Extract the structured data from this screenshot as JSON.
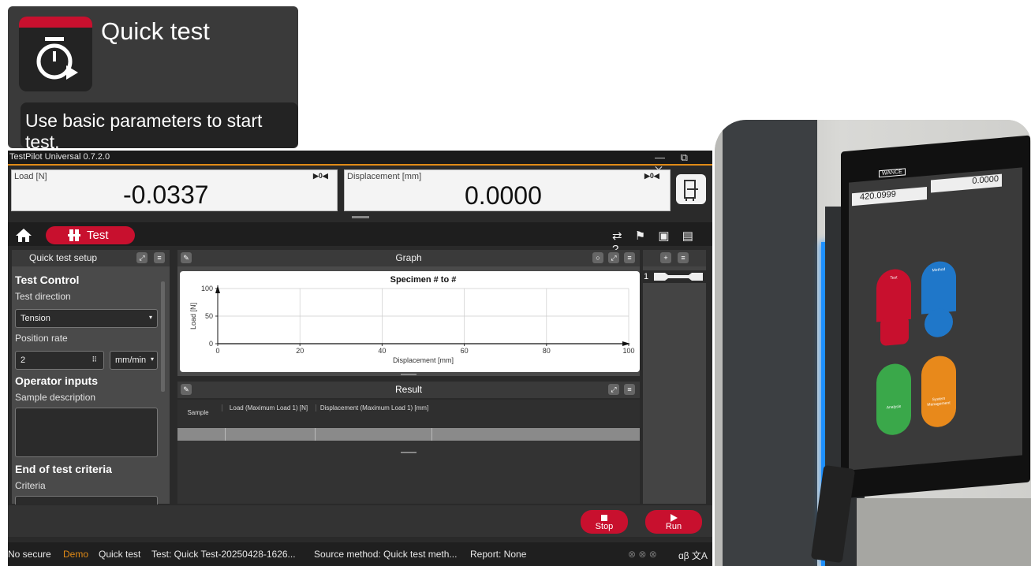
{
  "tile": {
    "title": "Quick test",
    "description": "Use basic parameters to start test."
  },
  "window": {
    "title": "TestPilot Universal 0.7.2.0",
    "controls": "— ⧉ ✕"
  },
  "readouts": {
    "load": {
      "label": "Load [N]",
      "value": "-0.0337",
      "tare": "▶0◀"
    },
    "displacement": {
      "label": "Displacement [mm]",
      "value": "0.0000",
      "tare": "▶0◀"
    }
  },
  "nav": {
    "tab_label": "Test",
    "toolbar_icons": "⇄ ⚑ ▣ ▤ ?"
  },
  "setup": {
    "header": "Quick test setup",
    "test_control": "Test Control",
    "test_direction_label": "Test direction",
    "test_direction_value": "Tension",
    "position_rate_label": "Position rate",
    "position_rate_value": "2",
    "position_rate_unit": "mm/min",
    "operator_inputs": "Operator inputs",
    "sample_description_label": "Sample description",
    "end_criteria": "End of test criteria",
    "criteria_label": "Criteria"
  },
  "graph": {
    "header": "Graph"
  },
  "chart_data": {
    "type": "line",
    "title": "Specimen # to #",
    "xlabel": "Displacement [mm]",
    "ylabel": "Load [N]",
    "xlim": [
      0,
      100
    ],
    "ylim": [
      0,
      100
    ],
    "xticks": [
      "0",
      "20",
      "40",
      "60",
      "80",
      "100"
    ],
    "yticks": [
      "0",
      "50",
      "100"
    ],
    "grid": true,
    "series": [
      {
        "x": [
          0,
          100
        ],
        "y": [
          0,
          0
        ]
      }
    ]
  },
  "result": {
    "header": "Result",
    "columns": [
      "Sample",
      "Load (Maximum Load 1) [N]",
      "Displacement (Maximum Load 1) [mm]"
    ]
  },
  "sidebar": {
    "specimen_label": "1"
  },
  "actions": {
    "stop_label": "Stop",
    "run_label": "Run"
  },
  "status": {
    "security": "No secure",
    "mode": "Demo",
    "type": "Quick test",
    "test": "Test: Quick Test-20250428-1626...",
    "source": "Source method: Quick test meth...",
    "report": "Report: None",
    "language_icon": "ɑβ 文A"
  },
  "photo": {
    "brand": "WANCE",
    "readout_left": "420.0999",
    "readout_right": "0.0000",
    "cards": [
      {
        "label": "Test",
        "color": "#c8102e"
      },
      {
        "label": "Method",
        "color": "#1f77c9"
      },
      {
        "label": "Analysis",
        "color": "#3aa84a"
      },
      {
        "label": "System Management",
        "color": "#e8891b"
      }
    ]
  }
}
